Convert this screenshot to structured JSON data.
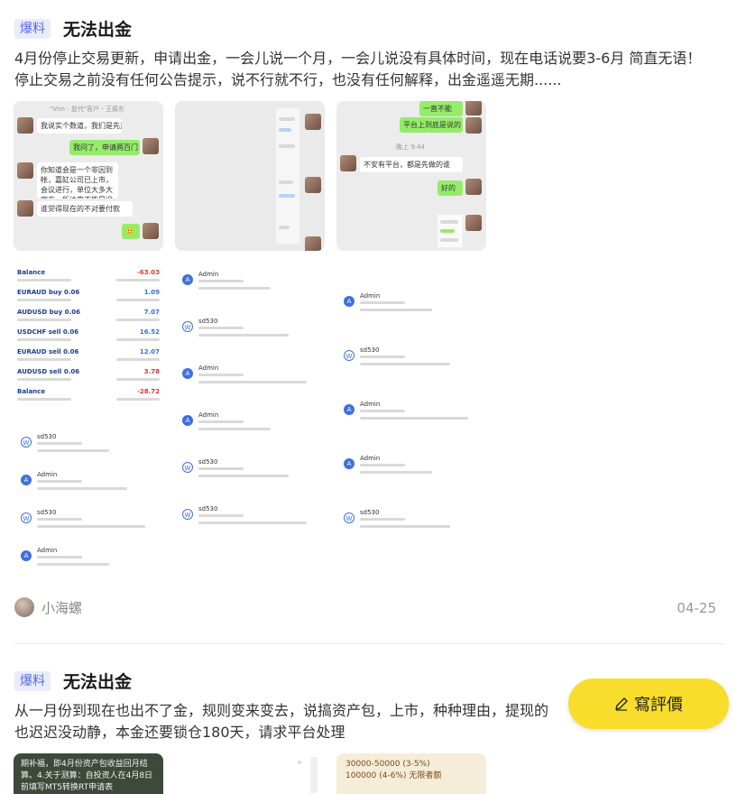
{
  "posts": [
    {
      "tag": "爆料",
      "title": "无法出金",
      "body_line1": "4月份停止交易更新，申请出金，一会儿说一个月，一会儿说没有具体时间，现在电话说要3-6月 简直无语！",
      "body_line2": "停止交易之前没有任何公告提示，说不行就不行，也没有任何解释，出金遥遥无期......",
      "author": "小海螺",
      "date": "04-25",
      "images": {
        "chat1": {
          "header": "\"Vnn - 复代\"客户 - 王振东",
          "msgs": [
            "我说实个数道，我们是先对人",
            "我问了，申请两百门",
            "你知道会是一个非因到帐，嘉缸公司已上市，会议进行，单位大多大官方，所达来不能是没问题",
            "谁觉得现在的不对要付款",
            "🙂"
          ]
        },
        "chat3": {
          "msgs": [
            "一直不能",
            "平台上到底是说的",
            "不安有平台，都是先做的谁",
            "好的"
          ],
          "sys": "晚上 9:44"
        },
        "ledger": {
          "rows": [
            {
              "sym": "Balance",
              "val": "-63.03"
            },
            {
              "sym": "EURAUD buy 0.06",
              "val": "1.09"
            },
            {
              "sym": "AUDUSD buy 0.06",
              "val": "7.07"
            },
            {
              "sym": "USDCHF sell 0.06",
              "val": "16.52"
            },
            {
              "sym": "EURAUD sell 0.06",
              "val": "12.07"
            },
            {
              "sym": "AUDUSD sell 0.06",
              "val": "3.78"
            },
            {
              "sym": "Balance",
              "val": "-28.72"
            }
          ],
          "names": [
            "sd530",
            "Admin",
            "sd530",
            "Admin"
          ]
        },
        "thread2": {
          "names": [
            "Admin",
            "sd530",
            "Admin",
            "Admin",
            "sd530",
            "sd530"
          ]
        },
        "thread3": {
          "names": [
            "Admin",
            "sd530",
            "Admin",
            "Admin",
            "sd530"
          ]
        }
      }
    },
    {
      "tag": "爆料",
      "title": "无法出金",
      "body_line1": "从一月份到现在也出不了金，规则变来变去，说搞资产包，上市，种种理由，提现的",
      "body_line2": "也迟迟没动静，本金还要锁仓180天，请求平台处理",
      "img1_text": "期补福，即4月份资产包收益回月结算。4.关于测算：自投资人在4月8日前填写MT5转换RT申请表",
      "img3_text": "30000-50000 (3-5%) 100000 (4-6%) 无限者额"
    }
  ],
  "review_button": "寫評價",
  "colors": {
    "accent": "#f9dd2c",
    "tag_bg": "#e9ecfb",
    "tag_text": "#5a6bd8",
    "chat_green": "#95ec69",
    "loss_red": "#e0352b",
    "gain_blue": "#2f6fe0"
  }
}
